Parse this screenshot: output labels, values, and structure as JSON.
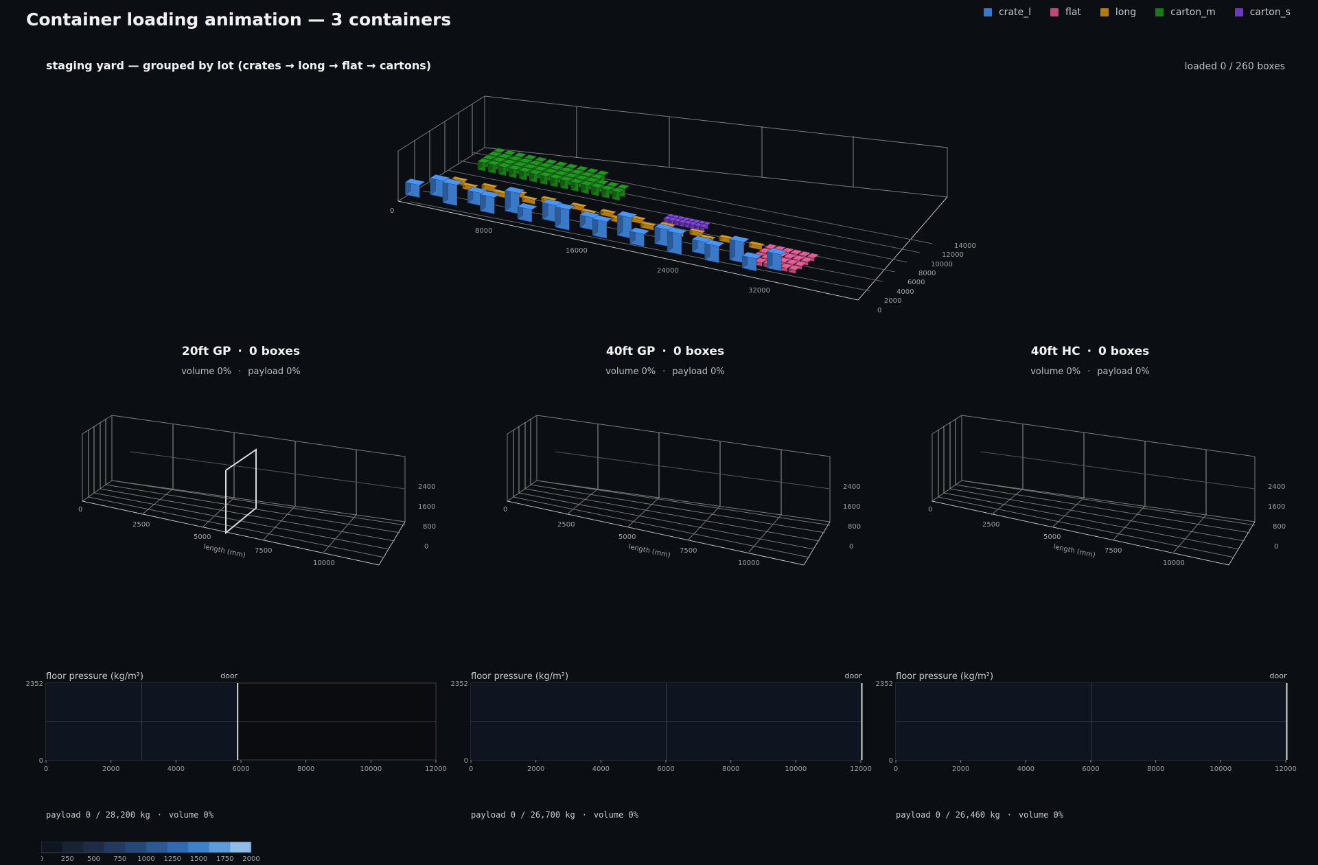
{
  "page": {
    "title": "Container loading animation — 3 containers"
  },
  "legend": [
    {
      "label": "crate_l",
      "color": "#3a78c8"
    },
    {
      "label": "flat",
      "color": "#b94b79"
    },
    {
      "label": "long",
      "color": "#b07c12"
    },
    {
      "label": "carton_m",
      "color": "#1a7a1a"
    },
    {
      "label": "carton_s",
      "color": "#6a3bb8"
    }
  ],
  "yard": {
    "title": "staging yard — grouped by lot (crates → long → flat → cartons)",
    "loaded": "loaded 0 / 260 boxes",
    "x_ticks": [
      "0",
      "8000",
      "16000",
      "24000",
      "32000"
    ],
    "y_ticks": [
      "0",
      "2000",
      "4000",
      "6000",
      "8000",
      "10000",
      "12000",
      "14000"
    ]
  },
  "containers": [
    {
      "name": "20ft GP",
      "boxes": "0 boxes",
      "volume": "volume 0%",
      "payload": "payload 0%",
      "length_ticks": [
        "0",
        "2500",
        "5000",
        "7500",
        "10000"
      ],
      "height_ticks": [
        "2400",
        "1600",
        "800",
        "0"
      ],
      "axis_label": "length (mm)",
      "floor": {
        "title": "floor pressure (kg/m²)",
        "door": "door",
        "ymax": "2352",
        "ymin": "0",
        "x_ticks": [
          "0",
          "2000",
          "4000",
          "6000",
          "8000",
          "10000",
          "12000"
        ],
        "door_at": 5898
      },
      "footer": {
        "payload": "payload 0 / 28,200 kg",
        "volume": "volume 0%"
      }
    },
    {
      "name": "40ft GP",
      "boxes": "0 boxes",
      "volume": "volume 0%",
      "payload": "payload 0%",
      "length_ticks": [
        "0",
        "2500",
        "5000",
        "7500",
        "10000"
      ],
      "height_ticks": [
        "2400",
        "1600",
        "800",
        "0"
      ],
      "axis_label": "length (mm)",
      "floor": {
        "title": "floor pressure (kg/m²)",
        "door": "door",
        "ymax": "2352",
        "ymin": "0",
        "x_ticks": [
          "0",
          "2000",
          "4000",
          "6000",
          "8000",
          "10000",
          "12000"
        ],
        "door_at": 12032
      },
      "footer": {
        "payload": "payload 0 / 26,700 kg",
        "volume": "volume 0%"
      }
    },
    {
      "name": "40ft HC",
      "boxes": "0 boxes",
      "volume": "volume 0%",
      "payload": "payload 0%",
      "length_ticks": [
        "0",
        "2500",
        "5000",
        "7500",
        "10000"
      ],
      "height_ticks": [
        "2400",
        "1600",
        "800",
        "0"
      ],
      "axis_label": "length (mm)",
      "floor": {
        "title": "floor pressure (kg/m²)",
        "door": "door",
        "ymax": "2352",
        "ymin": "0",
        "x_ticks": [
          "0",
          "2000",
          "4000",
          "6000",
          "8000",
          "10000",
          "12000"
        ],
        "door_at": 12032
      },
      "footer": {
        "payload": "payload 0 / 26,460 kg",
        "volume": "volume 0%"
      }
    }
  ],
  "colorbar": {
    "ticks": [
      "0",
      "250",
      "500",
      "750",
      "1000",
      "1250",
      "1500",
      "1750",
      "2000"
    ]
  },
  "chart_data": {
    "type": "floor-pressure",
    "xlabel": "",
    "ylabel": "floor pressure (kg/m²)",
    "ylim": [
      0,
      2352
    ],
    "xlim": [
      0,
      12000
    ],
    "series": []
  }
}
